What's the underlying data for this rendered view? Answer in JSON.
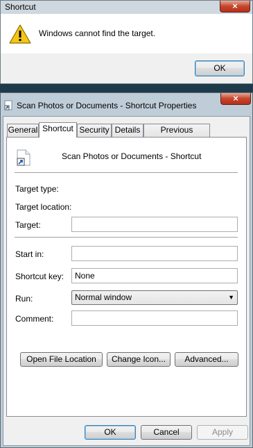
{
  "alert": {
    "title": "Shortcut",
    "message": "Windows cannot find the target.",
    "close_symbol": "×",
    "ok_label": "OK",
    "icon": "warning-icon"
  },
  "props": {
    "title": "Scan Photos or Documents - Shortcut Properties",
    "close_symbol": "×",
    "tabs": [
      "General",
      "Shortcut",
      "Security",
      "Details",
      "Previous Versions"
    ],
    "active_tab": "Shortcut",
    "shortcut_name": "Scan Photos or Documents - Shortcut",
    "fields": {
      "target_type_label": "Target type:",
      "target_location_label": "Target location:",
      "target_label": "Target:",
      "target_value": "",
      "start_in_label": "Start in:",
      "start_in_value": "",
      "shortcut_key_label": "Shortcut key:",
      "shortcut_key_value": "None",
      "run_label": "Run:",
      "run_value": "Normal window",
      "comment_label": "Comment:",
      "comment_value": ""
    },
    "buttons": {
      "open_file_location": "Open File Location",
      "change_icon": "Change Icon...",
      "advanced": "Advanced...",
      "ok": "OK",
      "cancel": "Cancel",
      "apply": "Apply"
    }
  },
  "colors": {
    "close_red": "#c7452b",
    "frame": "#bfcdd8",
    "default_button_border": "#3c7fb1"
  }
}
